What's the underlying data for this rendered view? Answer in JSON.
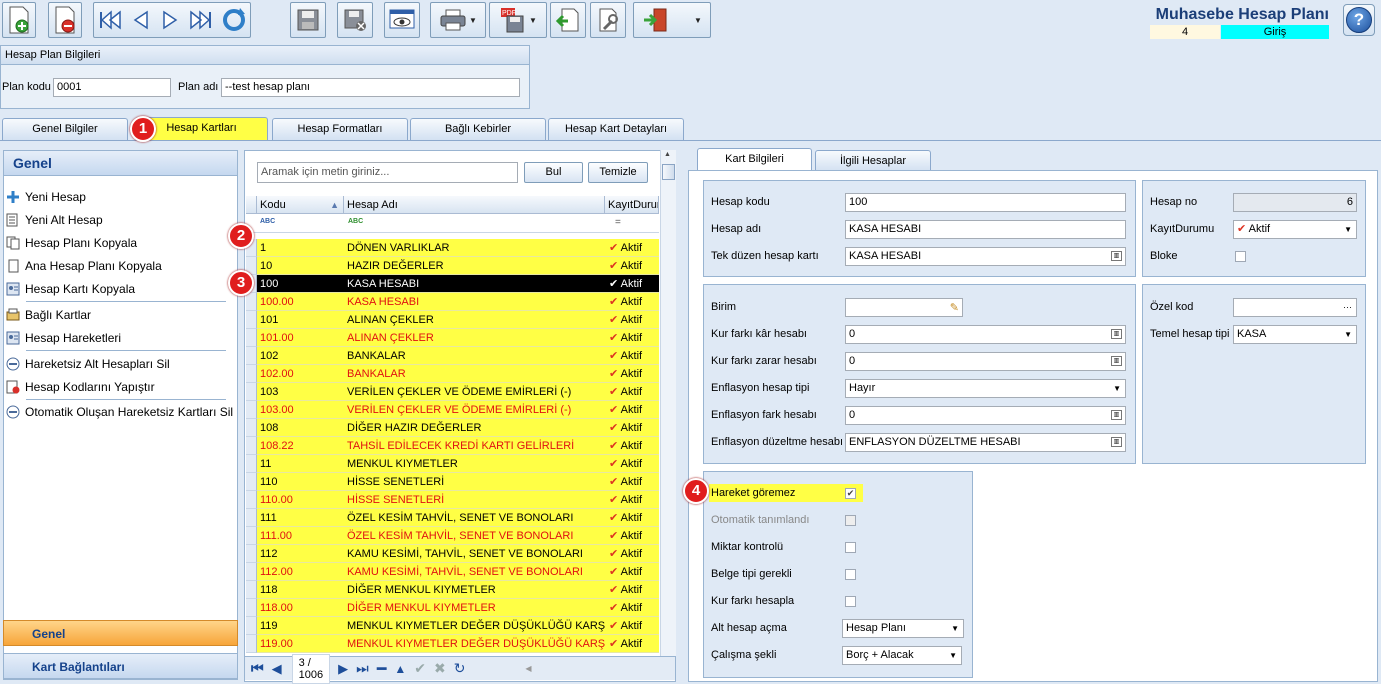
{
  "app": {
    "title": "Muhasebe Hesap Planı",
    "counter": "4",
    "mode": "Giriş",
    "help": "?"
  },
  "toolbar": {
    "icons": [
      "new-doc-icon",
      "delete-doc-icon",
      "first-icon",
      "prev-icon",
      "next-icon",
      "last-icon",
      "refresh-icon",
      "save-icon",
      "save-cancel-icon",
      "preview-icon",
      "print-icon",
      "pdf-export-icon",
      "import-icon",
      "tools-icon",
      "exit-icon"
    ]
  },
  "plan": {
    "group_title": "Hesap Plan Bilgileri",
    "code_label": "Plan kodu",
    "code_value": "0001",
    "name_label": "Plan adı",
    "name_value": "--test hesap planı"
  },
  "tabs": [
    {
      "label": "Genel Bilgiler"
    },
    {
      "label": "Hesap Kartları"
    },
    {
      "label": "Hesap Formatları"
    },
    {
      "label": "Bağlı Kebirler"
    },
    {
      "label": "Hesap Kart Detayları"
    }
  ],
  "badges": [
    "1",
    "2",
    "3",
    "4"
  ],
  "left": {
    "header": "Genel",
    "items": [
      {
        "label": "Yeni Hesap"
      },
      {
        "label": "Yeni Alt Hesap"
      },
      {
        "label": "Hesap Planı Kopyala"
      },
      {
        "label": "Ana Hesap Planı Kopyala"
      },
      {
        "label": "Hesap Kartı Kopyala"
      },
      {
        "label": "Bağlı Kartlar"
      },
      {
        "label": "Hesap Hareketleri"
      },
      {
        "label": "Hareketsiz Alt Hesapları Sil"
      },
      {
        "label": "Hesap Kodlarını Yapıştır"
      },
      {
        "label": "Otomatik Oluşan Hareketsiz Kartları Sil"
      }
    ],
    "nav_general": "Genel",
    "nav_links": "Kart Bağlantıları"
  },
  "grid": {
    "search_placeholder": "Aramak için metin giriniz...",
    "find": "Bul",
    "clear": "Temizle",
    "columns": [
      "Kodu",
      "Hesap Adı",
      "KayıtDurum"
    ],
    "filter_abc": "ABC",
    "filter_eq": "=",
    "rows": [
      {
        "k": "1",
        "a": "DÖNEN VARLIKLAR",
        "s": "Aktif",
        "red": false
      },
      {
        "k": "10",
        "a": "HAZIR DEĞERLER",
        "s": "Aktif",
        "red": false
      },
      {
        "k": "100",
        "a": "KASA HESABI",
        "s": "Aktif",
        "red": false,
        "sel": true
      },
      {
        "k": "100.00",
        "a": "KASA HESABI",
        "s": "Aktif",
        "red": true
      },
      {
        "k": "101",
        "a": "ALINAN ÇEKLER",
        "s": "Aktif",
        "red": false
      },
      {
        "k": "101.00",
        "a": "ALINAN ÇEKLER",
        "s": "Aktif",
        "red": true
      },
      {
        "k": "102",
        "a": "BANKALAR",
        "s": "Aktif",
        "red": false
      },
      {
        "k": "102.00",
        "a": "BANKALAR",
        "s": "Aktif",
        "red": true
      },
      {
        "k": "103",
        "a": "VERİLEN ÇEKLER VE ÖDEME EMİRLERİ (-)",
        "s": "Aktif",
        "red": false
      },
      {
        "k": "103.00",
        "a": "VERİLEN ÇEKLER VE ÖDEME EMİRLERİ (-)",
        "s": "Aktif",
        "red": true
      },
      {
        "k": "108",
        "a": "DİĞER HAZIR DEĞERLER",
        "s": "Aktif",
        "red": false
      },
      {
        "k": "108.22",
        "a": "TAHSİL EDİLECEK KREDİ KARTI GELİRLERİ",
        "s": "Aktif",
        "red": true
      },
      {
        "k": "11",
        "a": "MENKUL KIYMETLER",
        "s": "Aktif",
        "red": false
      },
      {
        "k": "110",
        "a": "HİSSE SENETLERİ",
        "s": "Aktif",
        "red": false
      },
      {
        "k": "110.00",
        "a": "HİSSE SENETLERİ",
        "s": "Aktif",
        "red": true
      },
      {
        "k": "111",
        "a": "ÖZEL KESİM TAHVİL, SENET VE BONOLARI",
        "s": "Aktif",
        "red": false
      },
      {
        "k": "111.00",
        "a": "ÖZEL KESİM TAHVİL, SENET VE BONOLARI",
        "s": "Aktif",
        "red": true
      },
      {
        "k": "112",
        "a": "KAMU KESİMİ, TAHVİL, SENET VE BONOLARI",
        "s": "Aktif",
        "red": false
      },
      {
        "k": "112.00",
        "a": "KAMU KESİMİ, TAHVİL, SENET VE BONOLARI",
        "s": "Aktif",
        "red": true
      },
      {
        "k": "118",
        "a": "DİĞER MENKUL KIYMETLER",
        "s": "Aktif",
        "red": false
      },
      {
        "k": "118.00",
        "a": "DİĞER MENKUL KIYMETLER",
        "s": "Aktif",
        "red": true
      },
      {
        "k": "119",
        "a": "MENKUL KIYMETLER DEĞER DÜŞÜKLÜĞÜ KARŞILIĞI (",
        "s": "Aktif",
        "red": false
      },
      {
        "k": "119.00",
        "a": "MENKUL KIYMETLER DEĞER DÜŞÜKLÜĞÜ KARŞILIĞI (",
        "s": "Aktif",
        "red": true
      }
    ],
    "pager": "3 / 1006"
  },
  "right": {
    "tabs": [
      {
        "label": "Kart Bilgileri"
      },
      {
        "label": "İlgili Hesaplar"
      }
    ],
    "hesap_kodu_label": "Hesap kodu",
    "hesap_kodu": "100",
    "hesap_adi_label": "Hesap adı",
    "hesap_adi": "KASA HESABI",
    "tek_label": "Tek düzen hesap kartı",
    "tek": "KASA HESABI",
    "hesap_no_label": "Hesap no",
    "hesap_no": "6",
    "kayit_label": "KayıtDurumu",
    "kayit": "Aktif",
    "bloke_label": "Bloke",
    "birim_label": "Birim",
    "birim": "",
    "kar_label": "Kur farkı kâr hesabı",
    "kar": "0",
    "zarar_label": "Kur farkı zarar hesabı",
    "zarar": "0",
    "enf_tip_label": "Enflasyon hesap tipi",
    "enf_tip": "Hayır",
    "enf_fark_label": "Enflasyon fark hesabı",
    "enf_fark": "0",
    "enf_duz_label": "Enflasyon düzeltme hesabı",
    "enf_duz": "ENFLASYON DÜZELTME HESABI",
    "ozel_label": "Özel kod",
    "ozel": "",
    "temel_label": "Temel hesap tipi",
    "temel": "KASA",
    "hareket_label": "Hareket göremez",
    "oto_label": "Otomatik tanımlandı",
    "miktar_label": "Miktar kontrolü",
    "belge_label": "Belge tipi gerekli",
    "kurfark_label": "Kur farkı hesapla",
    "alt_label": "Alt hesap açma",
    "alt": "Hesap Planı",
    "calisma_label": "Çalışma şekli",
    "calisma": "Borç + Alacak"
  },
  "colors": {
    "highlight": "#ffff45",
    "red_text": "#e01010",
    "badge": "#e01d1d",
    "mode_bg": "#00ffff"
  }
}
